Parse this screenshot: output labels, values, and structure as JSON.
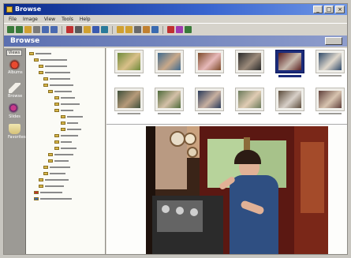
{
  "window": {
    "title": "Browse",
    "menu": [
      "File",
      "Image",
      "View",
      "Tools",
      "Help"
    ]
  },
  "header": {
    "title": "Browse"
  },
  "quickbar": {
    "tab": "Views",
    "items": [
      {
        "label": "Albums",
        "icon": "album-icon",
        "color": "#d23c2a"
      },
      {
        "label": "Browse",
        "icon": "browse-icon",
        "color": "#e8e4dc"
      },
      {
        "label": "Slides",
        "icon": "slideshow-icon",
        "color": "#7a2a8a"
      },
      {
        "label": "Favorites",
        "icon": "favorites-icon",
        "color": "#e8d070"
      }
    ]
  },
  "toolbar": {
    "tools": [
      "back-icon",
      "forward-icon",
      "up-icon",
      "cut-icon",
      "copy-icon",
      "paste-icon",
      "delete-icon",
      "undo-icon",
      "folder-icon",
      "search-icon",
      "view-icon",
      "rotate-left-icon",
      "rotate-right-icon",
      "crop-icon",
      "print-icon",
      "email-icon",
      "zoom-icon",
      "settings-icon",
      "help-icon"
    ],
    "tool_colors": [
      "#3a7a3a",
      "#3a7a3a",
      "#d0a030",
      "#7a7a7a",
      "#4a6ab0",
      "#4a6ab0",
      "#c03030",
      "#5a5a5a",
      "#d0a030",
      "#3a5ab0",
      "#2a7a9a",
      "#d0a030",
      "#d0a030",
      "#6a6a6a",
      "#c08030",
      "#3a6ab0",
      "#c03030",
      "#a03ab0",
      "#3a7a3a"
    ]
  },
  "selected_thumbnail": 4,
  "thumbnails": [
    {
      "name": "photo-girl-flowers",
      "c1": "#6f8a3a",
      "c2": "#d9c089"
    },
    {
      "name": "photo-child-outdoor",
      "c1": "#3f6a8f",
      "c2": "#c9a98a"
    },
    {
      "name": "photo-child-pink",
      "c1": "#7d4a2a",
      "c2": "#e7b9b9"
    },
    {
      "name": "photo-kids-closeup",
      "c1": "#2a2a2a",
      "c2": "#9b8a7a"
    },
    {
      "name": "photo-engine-cab",
      "c1": "#5a1f1f",
      "c2": "#c7b9ad"
    },
    {
      "name": "photo-boy-field",
      "c1": "#2f4a6a",
      "c2": "#e0d8cc"
    },
    {
      "name": "photo-kids-yard",
      "c1": "#3f4f3a",
      "c2": "#b69a7a"
    },
    {
      "name": "photo-family-group",
      "c1": "#4e6a3a",
      "c2": "#d4c0a8"
    },
    {
      "name": "photo-boy-train",
      "c1": "#2a3a5a",
      "c2": "#c8b0a0"
    },
    {
      "name": "photo-girl-sitting",
      "c1": "#6a7a5a",
      "c2": "#e0ccb4"
    },
    {
      "name": "photo-kids-play",
      "c1": "#5a4a3a",
      "c2": "#d8d0c8"
    },
    {
      "name": "photo-child-portrait",
      "c1": "#5f3f3a",
      "c2": "#d8c4b0"
    }
  ]
}
